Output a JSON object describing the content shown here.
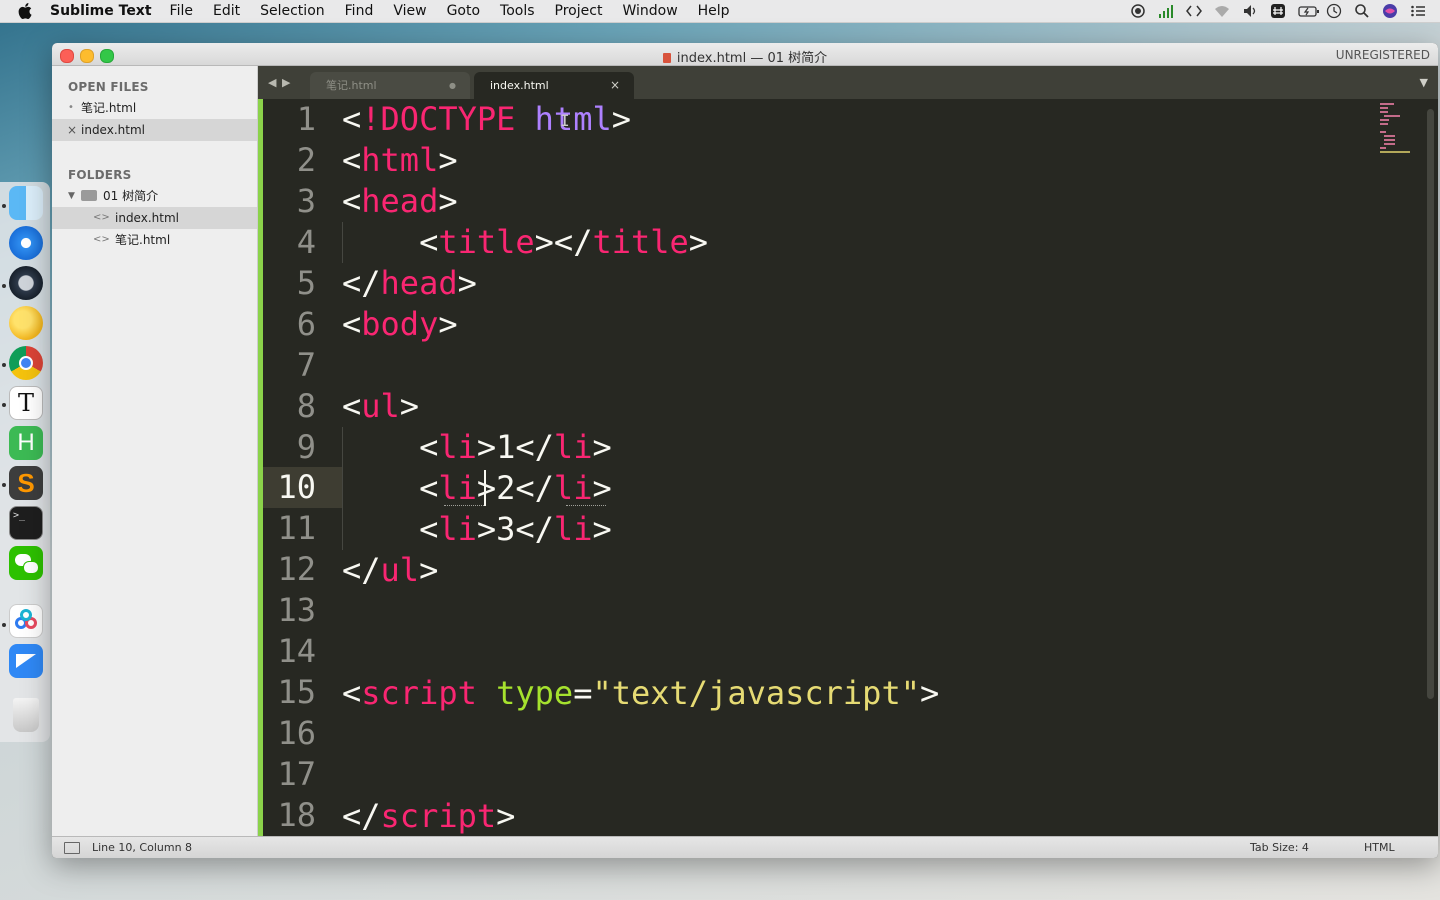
{
  "menubar": {
    "app_name": "Sublime Text",
    "items": [
      "File",
      "Edit",
      "Selection",
      "Find",
      "View",
      "Goto",
      "Tools",
      "Project",
      "Window",
      "Help"
    ],
    "status_icons": [
      "record-icon",
      "signal-icon",
      "code-icon",
      "wifi-icon",
      "volume-icon",
      "input-method-icon",
      "battery-icon",
      "clock-icon",
      "spotlight-icon",
      "siri-icon",
      "notification-center-icon"
    ]
  },
  "dock": {
    "apps": [
      "finder",
      "safari",
      "quicktime",
      "yellow-app",
      "chrome",
      "typora",
      "hbuilder",
      "sublime-text",
      "terminal",
      "wechat",
      "baidu-netdisk",
      "feishu",
      "trash"
    ]
  },
  "window": {
    "title": "index.html — 01 树简介",
    "unregistered": "UNREGISTERED"
  },
  "sidebar": {
    "open_files_heading": "OPEN FILES",
    "open_files": [
      {
        "name": "笔记.html",
        "marker": "•"
      },
      {
        "name": "index.html",
        "marker": "×"
      }
    ],
    "folders_heading": "FOLDERS",
    "folder_name": "01 树简介",
    "folder_files": [
      "index.html",
      "笔记.html"
    ],
    "file_glyph": "<>"
  },
  "tabs": {
    "back": "◀",
    "forward": "▶",
    "inactive_label": "笔记.html",
    "inactive_marker": "●",
    "active_label": "index.html",
    "active_close": "×",
    "dropdown": "▼"
  },
  "editor": {
    "line_numbers": [
      "1",
      "2",
      "3",
      "4",
      "5",
      "6",
      "7",
      "8",
      "9",
      "10",
      "11",
      "12",
      "13",
      "14",
      "15",
      "16",
      "17",
      "18"
    ],
    "current_line": "10"
  },
  "statusbar": {
    "position": "Line 10, Column 8",
    "tab_size": "Tab Size: 4",
    "syntax": "HTML"
  },
  "theme": {
    "editor_bg": "#272822",
    "tag": "#f92672",
    "attr": "#a6e22e",
    "string": "#e6db74",
    "text": "#f8f8f2",
    "gutter_accent": "#8bd24a"
  }
}
